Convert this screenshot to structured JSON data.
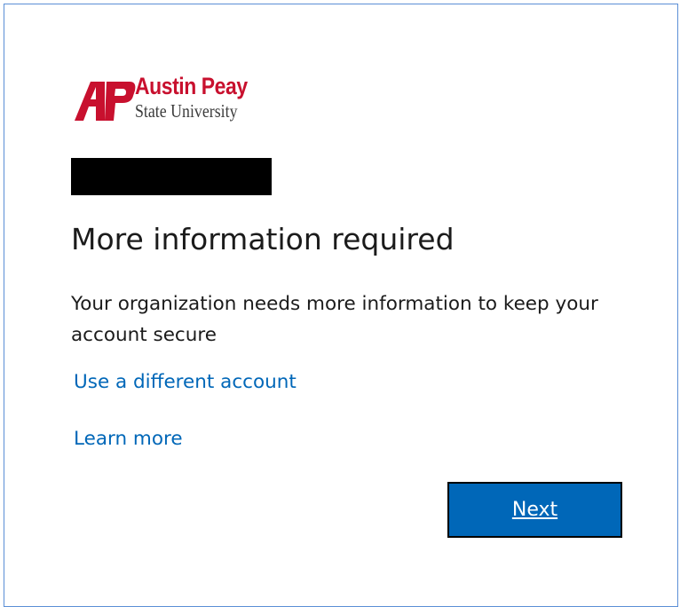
{
  "brand": {
    "logo_mark": "AP",
    "name_line1": "Austin Peay",
    "name_line2": "State University",
    "color": "#c8102e"
  },
  "redaction_color": "#000000",
  "title": "More information required",
  "description": "Your organization needs more information to keep your account secure",
  "links": {
    "different_account": "Use a different account",
    "learn_more": "Learn more",
    "color": "#0067b8"
  },
  "next_button": {
    "label": "Next",
    "color": "#0067b8"
  }
}
